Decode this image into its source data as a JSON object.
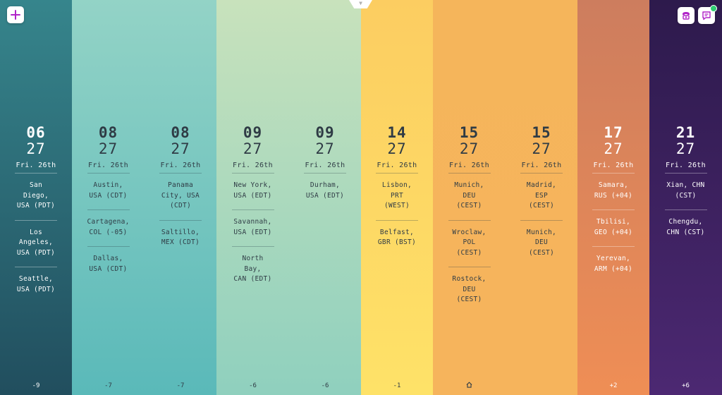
{
  "colors": {
    "accent": "#b022c8",
    "online_dot": "#2ecc71",
    "bands": [
      {
        "top": "#36858c",
        "bottom": "#214e5e",
        "fg": "#ffffff",
        "rule": "rgba(255,255,255,0.35)"
      },
      {
        "top": "#93d3c6",
        "bottom": "#5ab9b9",
        "fg": "#2f3b45",
        "rule": "rgba(40,60,70,0.3)"
      },
      {
        "top": "#c8e2bc",
        "bottom": "#8fd0be",
        "fg": "#2f3b45",
        "rule": "rgba(40,60,70,0.3)"
      },
      {
        "top": "#fccd61",
        "bottom": "#fee268",
        "fg": "#2f3b45",
        "rule": "rgba(40,60,70,0.3)"
      },
      {
        "top": "#f5b55b",
        "bottom": "#f6b45c",
        "fg": "#2f3b45",
        "rule": "rgba(40,60,70,0.3)"
      },
      {
        "top": "#cd7d5e",
        "bottom": "#ef8e55",
        "fg": "#ffffff",
        "rule": "rgba(255,255,255,0.35)"
      },
      {
        "top": "#2d1a4c",
        "bottom": "#4c2872",
        "fg": "#ffffff",
        "rule": "rgba(255,255,255,0.35)"
      }
    ]
  },
  "toolbar": {
    "add_icon": "plus-icon",
    "call_icon": "phone-icon",
    "chat_icon": "chat-icon",
    "handle_icon": "chevron-down-icon"
  },
  "columns": [
    {
      "band": 0,
      "hour": "06",
      "minute": "27",
      "day": "Fri. 26th",
      "offset": "-9",
      "cities": [
        [
          "San Diego,",
          "USA (PDT)"
        ],
        [
          "Los",
          "Angeles,",
          "USA (PDT)"
        ],
        [
          "Seattle,",
          "USA (PDT)"
        ]
      ]
    },
    {
      "band": 1,
      "hour": "08",
      "minute": "27",
      "day": "Fri. 26th",
      "offset": "-7",
      "cities": [
        [
          "Austin,",
          "USA (CDT)"
        ],
        [
          "Cartagena,",
          "COL (-05)"
        ],
        [
          "Dallas,",
          "USA (CDT)"
        ]
      ]
    },
    {
      "band": 1,
      "hour": "08",
      "minute": "27",
      "day": "Fri. 26th",
      "offset": "-7",
      "cities": [
        [
          "Panama",
          "City, USA",
          "(CDT)"
        ],
        [
          "Saltillo,",
          "MEX (CDT)"
        ]
      ]
    },
    {
      "band": 2,
      "hour": "09",
      "minute": "27",
      "day": "Fri. 26th",
      "offset": "-6",
      "cities": [
        [
          "New York,",
          "USA (EDT)"
        ],
        [
          "Savannah,",
          "USA (EDT)"
        ],
        [
          "North Bay,",
          "CAN (EDT)"
        ]
      ]
    },
    {
      "band": 2,
      "hour": "09",
      "minute": "27",
      "day": "Fri. 26th",
      "offset": "-6",
      "cities": [
        [
          "Durham,",
          "USA (EDT)"
        ]
      ]
    },
    {
      "band": 3,
      "hour": "14",
      "minute": "27",
      "day": "Fri. 26th",
      "offset": "-1",
      "cities": [
        [
          "Lisbon,",
          "PRT (WEST)"
        ],
        [
          "Belfast,",
          "GBR (BST)"
        ]
      ]
    },
    {
      "band": 4,
      "hour": "15",
      "minute": "27",
      "day": "Fri. 26th",
      "offset": "",
      "home": true,
      "cities": [
        [
          "Munich,",
          "DEU (CEST)"
        ],
        [
          "Wroclaw,",
          "POL (CEST)"
        ],
        [
          "Rostock,",
          "DEU (CEST)"
        ]
      ]
    },
    {
      "band": 4,
      "hour": "15",
      "minute": "27",
      "day": "Fri. 26th",
      "offset": "",
      "cities": [
        [
          "Madrid,",
          "ESP (CEST)"
        ],
        [
          "Munich,",
          "DEU (CEST)"
        ]
      ]
    },
    {
      "band": 5,
      "hour": "17",
      "minute": "27",
      "day": "Fri. 26th",
      "offset": "+2",
      "cities": [
        [
          "Samara,",
          "RUS (+04)"
        ],
        [
          "Tbilisi,",
          "GEO (+04)"
        ],
        [
          "Yerevan,",
          "ARM (+04)"
        ]
      ]
    },
    {
      "band": 6,
      "hour": "21",
      "minute": "27",
      "day": "Fri. 26th",
      "offset": "+6",
      "cities": [
        [
          "Xian, CHN",
          "(CST)"
        ],
        [
          "Chengdu,",
          "CHN (CST)"
        ]
      ]
    }
  ]
}
